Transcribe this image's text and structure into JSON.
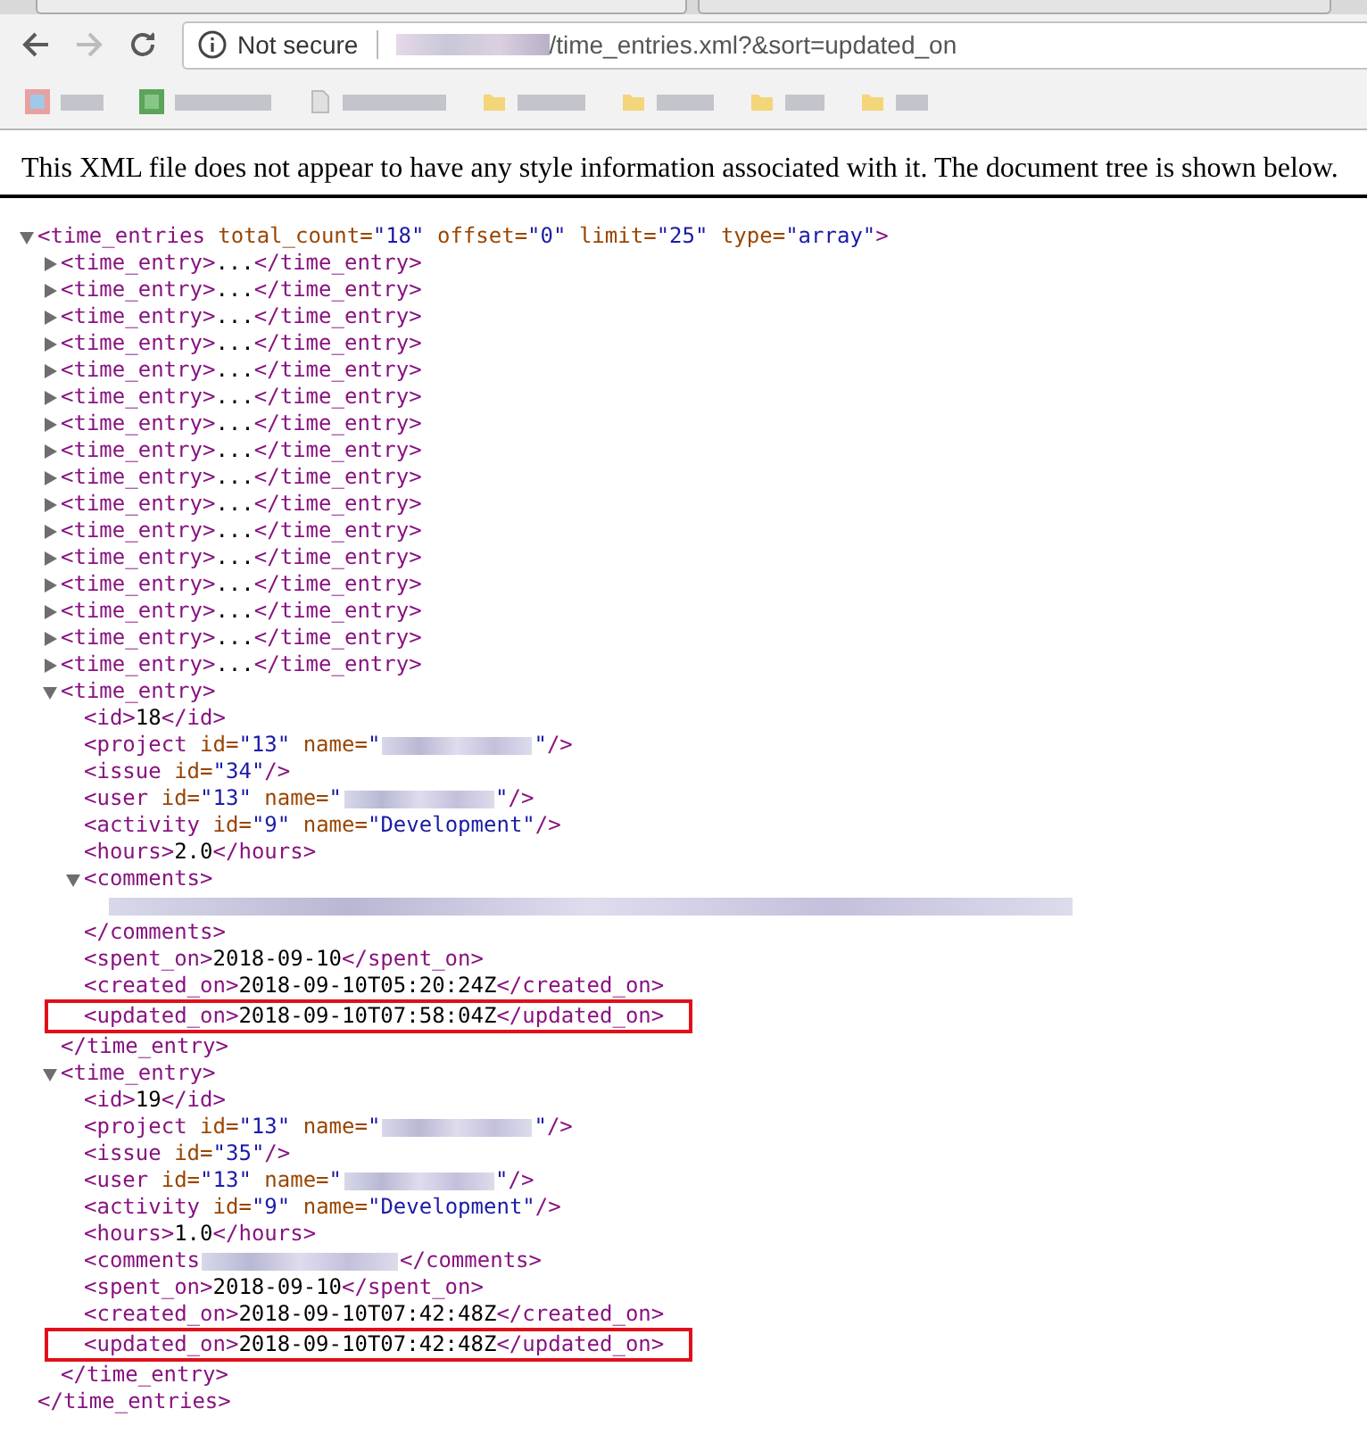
{
  "nav": {
    "back_enabled": true,
    "forward_enabled": false
  },
  "address_bar": {
    "security_label": "Not secure",
    "host_redacted": true,
    "path": "/time_entries.xml?&sort=updated_on"
  },
  "bookmarks": [
    {
      "kind": "favicon"
    },
    {
      "kind": "favicon"
    },
    {
      "kind": "page"
    },
    {
      "kind": "folder"
    },
    {
      "kind": "folder"
    },
    {
      "kind": "folder"
    },
    {
      "kind": "folder"
    }
  ],
  "info_message": "This XML file does not appear to have any style information associated with it. The document tree is shown below.",
  "xml": {
    "expanded": true,
    "segments": [
      {
        "kind": "tag",
        "text": "<time_entries"
      },
      {
        "kind": "attr",
        "text": " total_count="
      },
      {
        "kind": "value",
        "text": "\"18\""
      },
      {
        "kind": "attr",
        "text": " offset="
      },
      {
        "kind": "value",
        "text": "\"0\""
      },
      {
        "kind": "attr",
        "text": " limit="
      },
      {
        "kind": "value",
        "text": "\"25\""
      },
      {
        "kind": "attr",
        "text": " type="
      },
      {
        "kind": "value",
        "text": "\"array\""
      },
      {
        "kind": "tag",
        "text": ">"
      }
    ],
    "close": [
      {
        "kind": "tag",
        "text": "</time_entries>"
      }
    ],
    "children": [
      {
        "expanded": false,
        "segments": [
          {
            "kind": "tag",
            "text": "<time_entry>"
          },
          {
            "kind": "text",
            "text": "..."
          },
          {
            "kind": "tag",
            "text": "</time_entry>"
          }
        ]
      },
      {
        "expanded": false,
        "segments": [
          {
            "kind": "tag",
            "text": "<time_entry>"
          },
          {
            "kind": "text",
            "text": "..."
          },
          {
            "kind": "tag",
            "text": "</time_entry>"
          }
        ]
      },
      {
        "expanded": false,
        "segments": [
          {
            "kind": "tag",
            "text": "<time_entry>"
          },
          {
            "kind": "text",
            "text": "..."
          },
          {
            "kind": "tag",
            "text": "</time_entry>"
          }
        ]
      },
      {
        "expanded": false,
        "segments": [
          {
            "kind": "tag",
            "text": "<time_entry>"
          },
          {
            "kind": "text",
            "text": "..."
          },
          {
            "kind": "tag",
            "text": "</time_entry>"
          }
        ]
      },
      {
        "expanded": false,
        "segments": [
          {
            "kind": "tag",
            "text": "<time_entry>"
          },
          {
            "kind": "text",
            "text": "..."
          },
          {
            "kind": "tag",
            "text": "</time_entry>"
          }
        ]
      },
      {
        "expanded": false,
        "segments": [
          {
            "kind": "tag",
            "text": "<time_entry>"
          },
          {
            "kind": "text",
            "text": "..."
          },
          {
            "kind": "tag",
            "text": "</time_entry>"
          }
        ]
      },
      {
        "expanded": false,
        "segments": [
          {
            "kind": "tag",
            "text": "<time_entry>"
          },
          {
            "kind": "text",
            "text": "..."
          },
          {
            "kind": "tag",
            "text": "</time_entry>"
          }
        ]
      },
      {
        "expanded": false,
        "segments": [
          {
            "kind": "tag",
            "text": "<time_entry>"
          },
          {
            "kind": "text",
            "text": "..."
          },
          {
            "kind": "tag",
            "text": "</time_entry>"
          }
        ]
      },
      {
        "expanded": false,
        "segments": [
          {
            "kind": "tag",
            "text": "<time_entry>"
          },
          {
            "kind": "text",
            "text": "..."
          },
          {
            "kind": "tag",
            "text": "</time_entry>"
          }
        ]
      },
      {
        "expanded": false,
        "segments": [
          {
            "kind": "tag",
            "text": "<time_entry>"
          },
          {
            "kind": "text",
            "text": "..."
          },
          {
            "kind": "tag",
            "text": "</time_entry>"
          }
        ]
      },
      {
        "expanded": false,
        "segments": [
          {
            "kind": "tag",
            "text": "<time_entry>"
          },
          {
            "kind": "text",
            "text": "..."
          },
          {
            "kind": "tag",
            "text": "</time_entry>"
          }
        ]
      },
      {
        "expanded": false,
        "segments": [
          {
            "kind": "tag",
            "text": "<time_entry>"
          },
          {
            "kind": "text",
            "text": "..."
          },
          {
            "kind": "tag",
            "text": "</time_entry>"
          }
        ]
      },
      {
        "expanded": false,
        "segments": [
          {
            "kind": "tag",
            "text": "<time_entry>"
          },
          {
            "kind": "text",
            "text": "..."
          },
          {
            "kind": "tag",
            "text": "</time_entry>"
          }
        ]
      },
      {
        "expanded": false,
        "segments": [
          {
            "kind": "tag",
            "text": "<time_entry>"
          },
          {
            "kind": "text",
            "text": "..."
          },
          {
            "kind": "tag",
            "text": "</time_entry>"
          }
        ]
      },
      {
        "expanded": false,
        "segments": [
          {
            "kind": "tag",
            "text": "<time_entry>"
          },
          {
            "kind": "text",
            "text": "..."
          },
          {
            "kind": "tag",
            "text": "</time_entry>"
          }
        ]
      },
      {
        "expanded": false,
        "segments": [
          {
            "kind": "tag",
            "text": "<time_entry>"
          },
          {
            "kind": "text",
            "text": "..."
          },
          {
            "kind": "tag",
            "text": "</time_entry>"
          }
        ]
      },
      {
        "expanded": true,
        "segments": [
          {
            "kind": "tag",
            "text": "<time_entry>"
          }
        ],
        "close": [
          {
            "kind": "tag",
            "text": "</time_entry>"
          }
        ],
        "children": [
          {
            "segments": [
              {
                "kind": "tag",
                "text": "<id>"
              },
              {
                "kind": "text",
                "text": "18"
              },
              {
                "kind": "tag",
                "text": "</id>"
              }
            ]
          },
          {
            "segments": [
              {
                "kind": "tag",
                "text": "<project"
              },
              {
                "kind": "attr",
                "text": " id="
              },
              {
                "kind": "value",
                "text": "\"13\""
              },
              {
                "kind": "attr",
                "text": " name="
              },
              {
                "kind": "value",
                "text": "\""
              },
              {
                "kind": "redacted"
              },
              {
                "kind": "value",
                "text": "\""
              },
              {
                "kind": "tag",
                "text": "/>"
              }
            ]
          },
          {
            "segments": [
              {
                "kind": "tag",
                "text": "<issue"
              },
              {
                "kind": "attr",
                "text": " id="
              },
              {
                "kind": "value",
                "text": "\"34\""
              },
              {
                "kind": "tag",
                "text": "/>"
              }
            ]
          },
          {
            "segments": [
              {
                "kind": "tag",
                "text": "<user"
              },
              {
                "kind": "attr",
                "text": " id="
              },
              {
                "kind": "value",
                "text": "\"13\""
              },
              {
                "kind": "attr",
                "text": " name="
              },
              {
                "kind": "value",
                "text": "\""
              },
              {
                "kind": "redacted"
              },
              {
                "kind": "value",
                "text": "\""
              },
              {
                "kind": "tag",
                "text": "/>"
              }
            ]
          },
          {
            "segments": [
              {
                "kind": "tag",
                "text": "<activity"
              },
              {
                "kind": "attr",
                "text": " id="
              },
              {
                "kind": "value",
                "text": "\"9\""
              },
              {
                "kind": "attr",
                "text": " name="
              },
              {
                "kind": "value",
                "text": "\"Development\""
              },
              {
                "kind": "tag",
                "text": "/>"
              }
            ]
          },
          {
            "segments": [
              {
                "kind": "tag",
                "text": "<hours>"
              },
              {
                "kind": "text",
                "text": "2.0"
              },
              {
                "kind": "tag",
                "text": "</hours>"
              }
            ]
          },
          {
            "expanded": true,
            "segments": [
              {
                "kind": "tag",
                "text": "<comments>"
              }
            ],
            "close": [
              {
                "kind": "tag",
                "text": "</comments>"
              }
            ],
            "children": [
              {
                "segments": [
                  {
                    "kind": "redacted"
                  }
                ]
              }
            ]
          },
          {
            "segments": [
              {
                "kind": "tag",
                "text": "<spent_on>"
              },
              {
                "kind": "text",
                "text": "2018-09-10"
              },
              {
                "kind": "tag",
                "text": "</spent_on>"
              }
            ]
          },
          {
            "segments": [
              {
                "kind": "tag",
                "text": "<created_on>"
              },
              {
                "kind": "text",
                "text": "2018-09-10T05:20:24Z"
              },
              {
                "kind": "tag",
                "text": "</created_on>"
              }
            ]
          },
          {
            "highlighted": true,
            "segments": [
              {
                "kind": "tag",
                "text": "<updated_on>"
              },
              {
                "kind": "text",
                "text": "2018-09-10T07:58:04Z"
              },
              {
                "kind": "tag",
                "text": "</updated_on>"
              }
            ]
          }
        ]
      },
      {
        "expanded": true,
        "segments": [
          {
            "kind": "tag",
            "text": "<time_entry>"
          }
        ],
        "close": [
          {
            "kind": "tag",
            "text": "</time_entry>"
          }
        ],
        "children": [
          {
            "segments": [
              {
                "kind": "tag",
                "text": "<id>"
              },
              {
                "kind": "text",
                "text": "19"
              },
              {
                "kind": "tag",
                "text": "</id>"
              }
            ]
          },
          {
            "segments": [
              {
                "kind": "tag",
                "text": "<project"
              },
              {
                "kind": "attr",
                "text": " id="
              },
              {
                "kind": "value",
                "text": "\"13\""
              },
              {
                "kind": "attr",
                "text": " name="
              },
              {
                "kind": "value",
                "text": "\""
              },
              {
                "kind": "redacted"
              },
              {
                "kind": "value",
                "text": "\""
              },
              {
                "kind": "tag",
                "text": "/>"
              }
            ]
          },
          {
            "segments": [
              {
                "kind": "tag",
                "text": "<issue"
              },
              {
                "kind": "attr",
                "text": " id="
              },
              {
                "kind": "value",
                "text": "\"35\""
              },
              {
                "kind": "tag",
                "text": "/>"
              }
            ]
          },
          {
            "segments": [
              {
                "kind": "tag",
                "text": "<user"
              },
              {
                "kind": "attr",
                "text": " id="
              },
              {
                "kind": "value",
                "text": "\"13\""
              },
              {
                "kind": "attr",
                "text": " name="
              },
              {
                "kind": "value",
                "text": "\""
              },
              {
                "kind": "redacted"
              },
              {
                "kind": "value",
                "text": "\""
              },
              {
                "kind": "tag",
                "text": "/>"
              }
            ]
          },
          {
            "segments": [
              {
                "kind": "tag",
                "text": "<activity"
              },
              {
                "kind": "attr",
                "text": " id="
              },
              {
                "kind": "value",
                "text": "\"9\""
              },
              {
                "kind": "attr",
                "text": " name="
              },
              {
                "kind": "value",
                "text": "\"Development\""
              },
              {
                "kind": "tag",
                "text": "/>"
              }
            ]
          },
          {
            "segments": [
              {
                "kind": "tag",
                "text": "<hours>"
              },
              {
                "kind": "text",
                "text": "1.0"
              },
              {
                "kind": "tag",
                "text": "</hours>"
              }
            ]
          },
          {
            "segments": [
              {
                "kind": "tag",
                "text": "<comments"
              },
              {
                "kind": "redacted"
              },
              {
                "kind": "tag",
                "text": "</comments>"
              }
            ]
          },
          {
            "segments": [
              {
                "kind": "tag",
                "text": "<spent_on>"
              },
              {
                "kind": "text",
                "text": "2018-09-10"
              },
              {
                "kind": "tag",
                "text": "</spent_on>"
              }
            ]
          },
          {
            "segments": [
              {
                "kind": "tag",
                "text": "<created_on>"
              },
              {
                "kind": "text",
                "text": "2018-09-10T07:42:48Z"
              },
              {
                "kind": "tag",
                "text": "</created_on>"
              }
            ]
          },
          {
            "highlighted": true,
            "segments": [
              {
                "kind": "tag",
                "text": "<updated_on>"
              },
              {
                "kind": "text",
                "text": "2018-09-10T07:42:48Z"
              },
              {
                "kind": "tag",
                "text": "</updated_on>"
              }
            ]
          }
        ]
      }
    ]
  }
}
